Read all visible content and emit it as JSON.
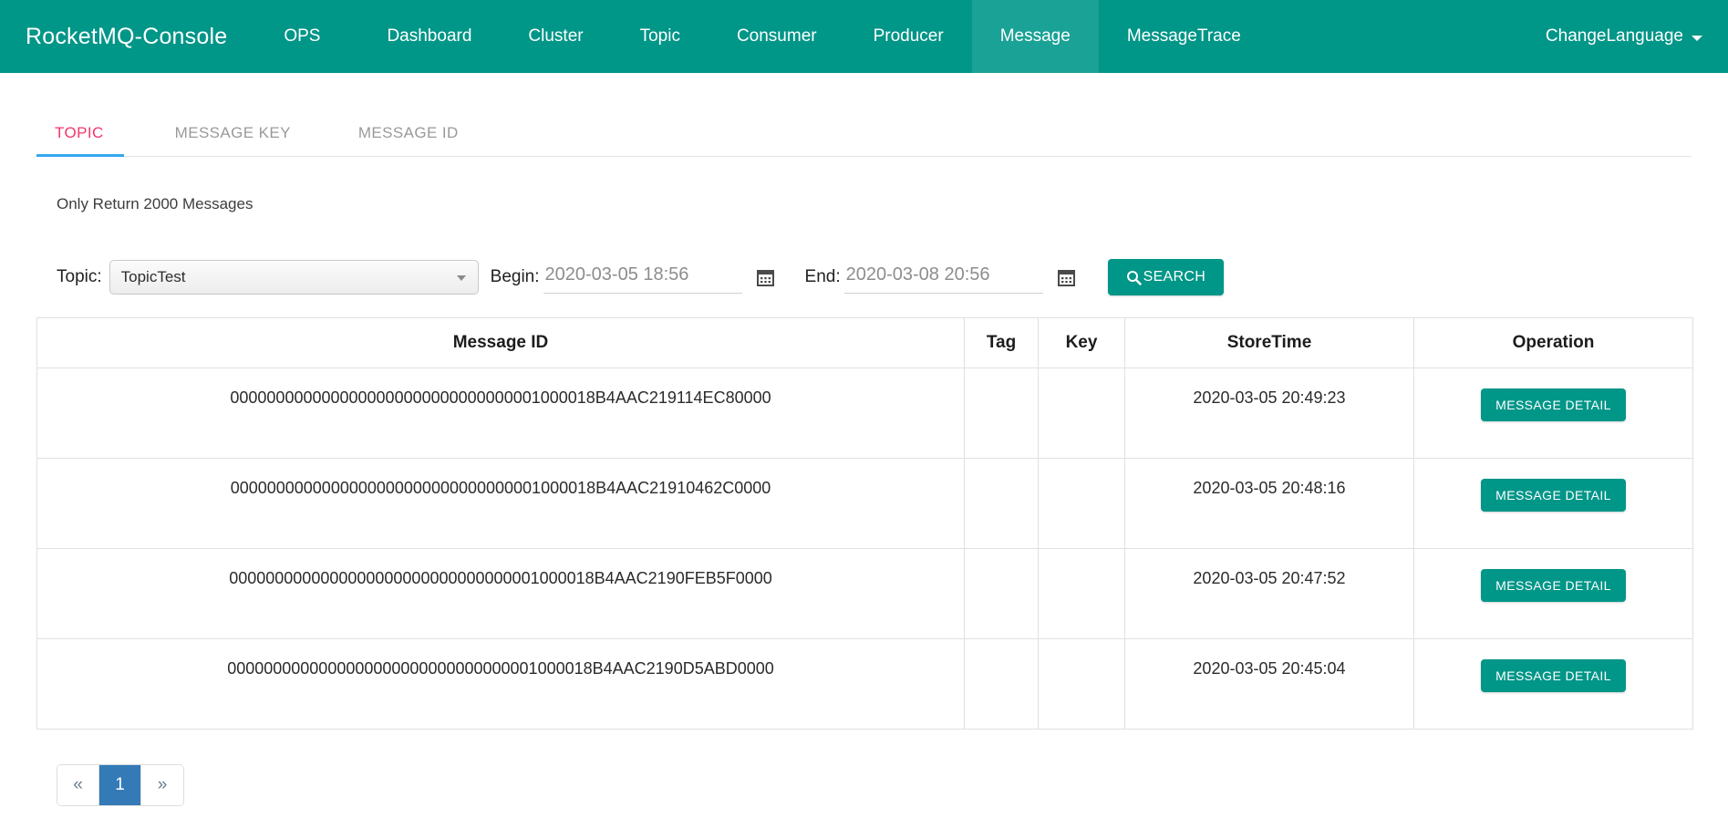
{
  "navbar": {
    "brand": "RocketMQ-Console",
    "items": [
      {
        "label": "OPS",
        "active": false
      },
      {
        "label": "Dashboard",
        "active": false
      },
      {
        "label": "Cluster",
        "active": false
      },
      {
        "label": "Topic",
        "active": false
      },
      {
        "label": "Consumer",
        "active": false
      },
      {
        "label": "Producer",
        "active": false
      },
      {
        "label": "Message",
        "active": true
      },
      {
        "label": "MessageTrace",
        "active": false
      }
    ],
    "language_label": "ChangeLanguage",
    "language_caret_icon": "chevron-down-icon",
    "background_color": "#009688",
    "active_background_color": "#1aa296"
  },
  "subtabs": [
    {
      "label": "TOPIC",
      "active": true
    },
    {
      "label": "MESSAGE KEY",
      "active": false
    },
    {
      "label": "MESSAGE ID",
      "active": false
    }
  ],
  "subtab_colors": {
    "active_text": "#f4356b",
    "active_underline": "#35a7f0",
    "inactive_text": "#9a9a9a"
  },
  "note": "Only Return 2000 Messages",
  "search": {
    "topic_label": "Topic:",
    "topic_value": "TopicTest",
    "topic_caret_icon": "chevron-down-icon",
    "begin_label": "Begin:",
    "begin_value": "",
    "begin_placeholder": "2020-03-05 18:56",
    "begin_calendar_icon": "calendar-icon",
    "end_label": "End:",
    "end_value": "",
    "end_placeholder": "2020-03-08 20:56",
    "end_calendar_icon": "calendar-icon",
    "search_button_label": "SEARCH",
    "search_button_icon": "search-icon",
    "button_color": "#009688"
  },
  "table": {
    "columns": [
      "Message ID",
      "Tag",
      "Key",
      "StoreTime",
      "Operation"
    ],
    "operation_button_label": "MESSAGE DETAIL",
    "rows": [
      {
        "message_id": "0000000000000000000000000000000001000018B4AAC219114EC80000",
        "tag": "",
        "key": "",
        "store_time": "2020-03-05 20:49:23"
      },
      {
        "message_id": "0000000000000000000000000000000001000018B4AAC21910462C0000",
        "tag": "",
        "key": "",
        "store_time": "2020-03-05 20:48:16"
      },
      {
        "message_id": "0000000000000000000000000000000001000018B4AAC2190FEB5F0000",
        "tag": "",
        "key": "",
        "store_time": "2020-03-05 20:47:52"
      },
      {
        "message_id": "0000000000000000000000000000000001000018B4AAC2190D5ABD0000",
        "tag": "",
        "key": "",
        "store_time": "2020-03-05 20:45:04"
      }
    ]
  },
  "pagination": {
    "prev_label": "«",
    "next_label": "»",
    "pages": [
      "1"
    ],
    "current_page": "1",
    "active_color": "#337ab7"
  }
}
